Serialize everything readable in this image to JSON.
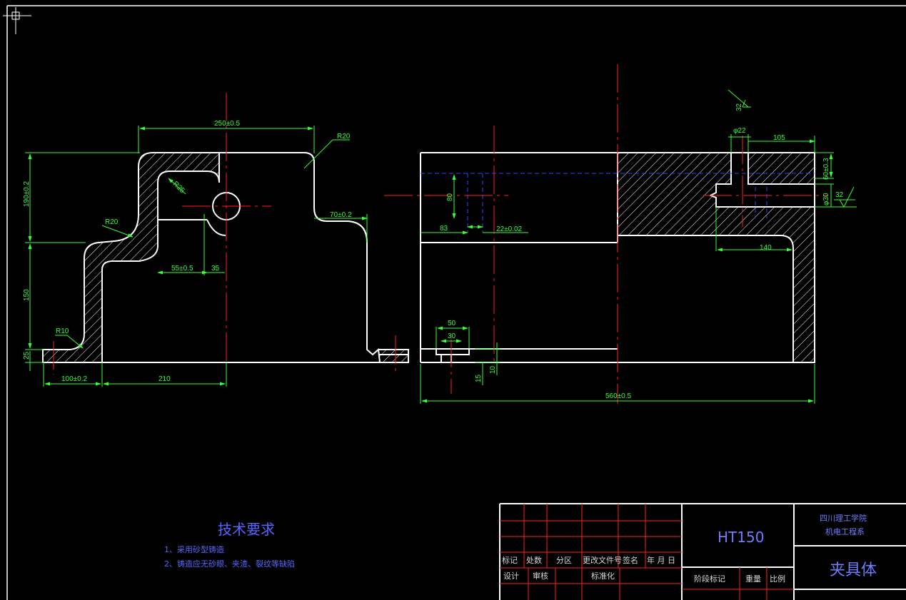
{
  "colors": {
    "background": "#000000",
    "outline": "#ffffff",
    "dimension": "#33ff33",
    "centerline": "#ff2020",
    "hidden": "#3344ff",
    "frame": "#ffffff",
    "titleblock_grid": "#ff2020",
    "titleblock_text": "#d8d8d8",
    "note_text": "#5566ff"
  },
  "front_view": {
    "dims": {
      "d_250": "250±0.5",
      "r20_top": "R20",
      "d_190": "190±0.2",
      "r25": "R25",
      "d_70": "70±0.2",
      "r20_left": "R20",
      "d_55": "55±0.5",
      "d_35": "35",
      "d_150": "150",
      "r10": "R10",
      "d_25": "25",
      "d_100": "100±0.2",
      "d_210": "210"
    }
  },
  "side_view": {
    "dims": {
      "d_32_top": "32",
      "d_phi22": "φ22",
      "d_105": "105",
      "d_60": "60±0.3",
      "d_phi30": "φ30",
      "d_32_right": "32",
      "d_80": "80",
      "d_83": "83",
      "d_22": "22±0.02",
      "d_140": "140",
      "d_50": "50",
      "d_30": "30",
      "d_15": "15",
      "d_10": "10",
      "d_560": "560±0.5"
    }
  },
  "notes": {
    "title": "技术要求",
    "line1": "1、采用砂型铸造",
    "line2": "2、铸造应无砂眼、夹渣、裂纹等缺陷"
  },
  "title_block": {
    "material": "HT150",
    "school_line1": "四川理工学院",
    "school_line2": "机电工程系",
    "part_name": "夹具体",
    "row_labels": [
      "标记",
      "处数",
      "分区",
      "更改文件号",
      "签名",
      "年 月 日"
    ],
    "sign_labels": [
      "设计",
      "审核",
      "标准化"
    ],
    "stage_label": "阶段标记",
    "weight_label": "重量",
    "scale_label": "比例"
  }
}
